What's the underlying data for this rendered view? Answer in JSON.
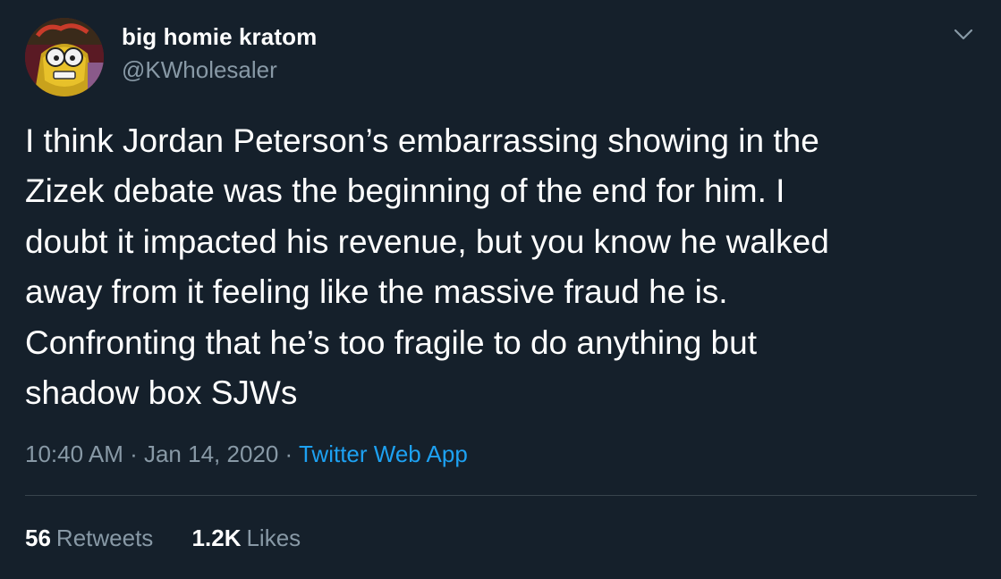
{
  "user": {
    "display_name": "big homie kratom",
    "handle": "@KWholesaler"
  },
  "tweet": {
    "text": "I think Jordan Peterson’s embarrassing showing in the\nZizek debate was the beginning of the end for him. I\ndoubt it impacted his revenue, but you know he walked\naway from it feeling like the massive fraud he is.\nConfronting that he’s too fragile to do anything but\nshadow box SJWs",
    "time": "10:40 AM",
    "separator": " · ",
    "date": "Jan 14, 2020",
    "source": "Twitter Web App"
  },
  "stats": {
    "retweets_count": "56",
    "retweets_label": "Retweets",
    "likes_count": "1.2K",
    "likes_label": "Likes"
  },
  "icons": {
    "caret": "chevron-down-icon",
    "avatar": "avatar-image"
  },
  "colors": {
    "background": "#15202b",
    "secondary_text": "#8899a6",
    "link": "#1da1f2",
    "divider": "#38444d"
  }
}
